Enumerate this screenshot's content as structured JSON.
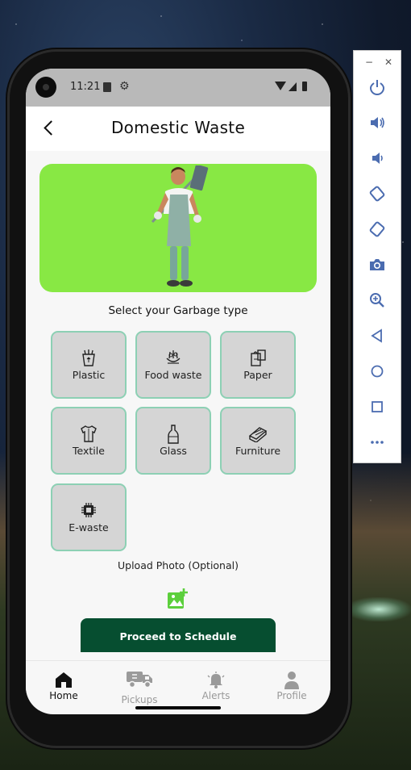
{
  "status_bar": {
    "time": "11:21"
  },
  "header": {
    "title": "Domestic Waste"
  },
  "section_label": "Select your Garbage type",
  "garbage_types": [
    {
      "label": "Plastic",
      "icon": "plastic-bin-icon"
    },
    {
      "label": "Food waste",
      "icon": "food-waste-icon"
    },
    {
      "label": "Paper",
      "icon": "paper-bag-icon"
    },
    {
      "label": "Textile",
      "icon": "shirt-icon"
    },
    {
      "label": "Glass",
      "icon": "bottle-icon"
    },
    {
      "label": "Furniture",
      "icon": "furniture-icon"
    },
    {
      "label": "E-waste",
      "icon": "chip-icon"
    }
  ],
  "upload": {
    "label": "Upload Photo (Optional)",
    "icon": "add-photo-icon"
  },
  "proceed_button": {
    "label": "Proceed to Schedule"
  },
  "bottom_nav": [
    {
      "label": "Home",
      "icon": "home-icon",
      "active": true
    },
    {
      "label": "Pickups",
      "icon": "truck-icon",
      "active": false
    },
    {
      "label": "Alerts",
      "icon": "bell-icon",
      "active": false
    },
    {
      "label": "Profile",
      "icon": "person-icon",
      "active": false
    }
  ],
  "emulator_panel": {
    "buttons": [
      "power-icon",
      "volume-up-icon",
      "volume-down-icon",
      "rotate-left-icon",
      "rotate-right-icon",
      "camera-icon",
      "zoom-icon",
      "back-icon",
      "home-circle-icon",
      "overview-icon",
      "more-icon"
    ]
  },
  "colors": {
    "accent_green": "#88e844",
    "tile_border": "#8dd0b4",
    "button_dark_green": "#064e30",
    "upload_icon_green": "#5ccf3c"
  }
}
